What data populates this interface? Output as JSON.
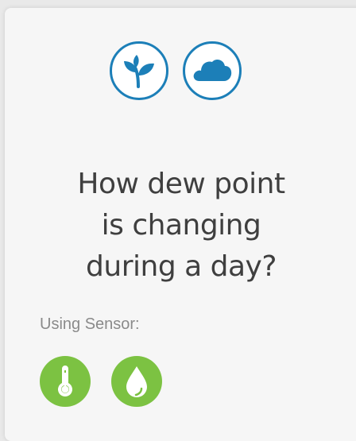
{
  "topic_icons": [
    {
      "icon": "plant-icon",
      "color": "#1c7fb8"
    },
    {
      "icon": "cloud-icon",
      "color": "#1c7fb8"
    }
  ],
  "title_lines": [
    "How dew point",
    "is changing",
    "during a day?"
  ],
  "sensor_label": "Using Sensor:",
  "sensors": [
    {
      "icon": "thermometer-icon",
      "color": "#7cc242"
    },
    {
      "icon": "water-drop-icon",
      "color": "#7cc242"
    }
  ]
}
